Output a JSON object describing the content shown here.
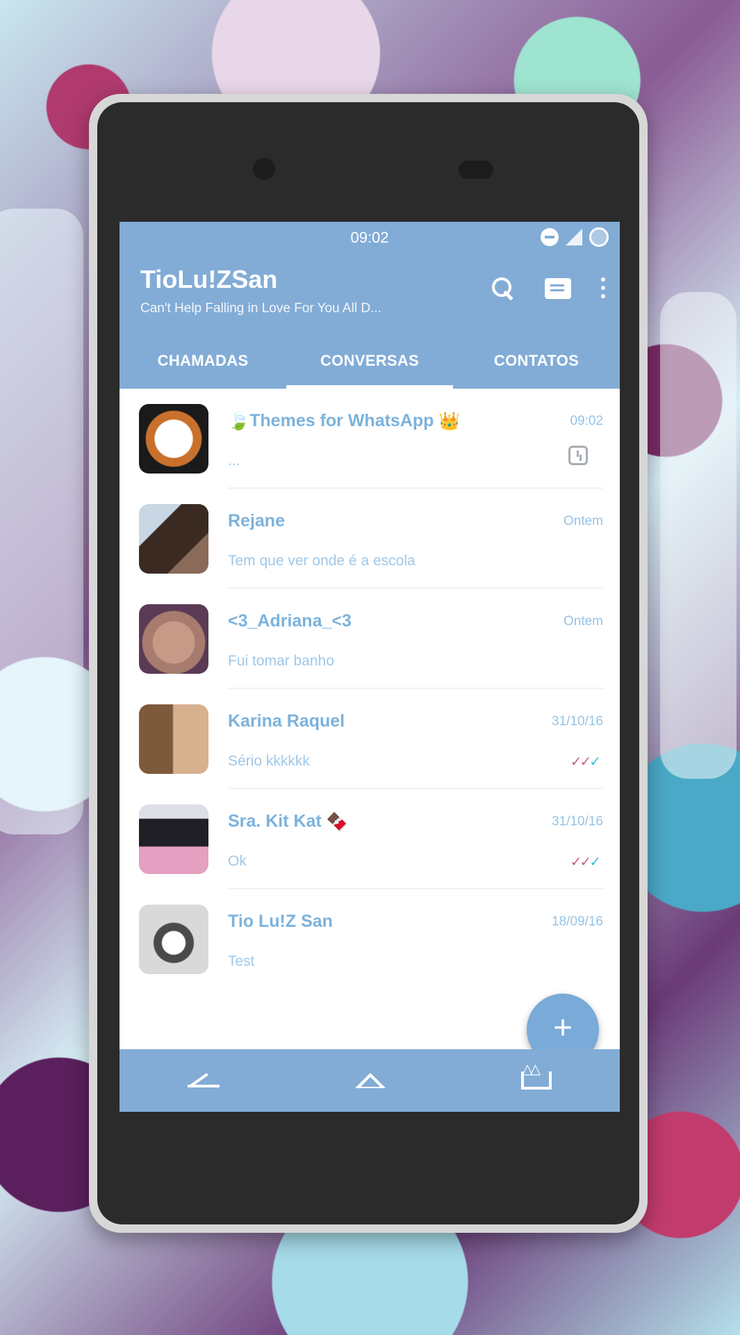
{
  "status_bar": {
    "time": "09:02"
  },
  "header": {
    "title": "TioLu!ZSan",
    "subtitle": "Can't Help Falling in Love For You All D...",
    "accent_color": "#82acd6"
  },
  "tabs": [
    {
      "label": "CHAMADAS",
      "active": false
    },
    {
      "label": "CONVERSAS",
      "active": true
    },
    {
      "label": "CONTATOS",
      "active": false
    }
  ],
  "chats": [
    {
      "name": "Themes for WhatsApp",
      "leading_emoji": "🍃",
      "trailing_emoji": "👑",
      "time": "09:02",
      "preview": "...",
      "status": "clock-icon",
      "avatar_colors": [
        "#ffffff",
        "#c9702c"
      ]
    },
    {
      "name": "Rejane",
      "time": "Ontem",
      "preview": "Tem que ver onde é a escola",
      "status": "",
      "avatar_colors": [
        "#3a2a22",
        "#c9d6e4"
      ]
    },
    {
      "name": "<3_Adriana_<3",
      "time": "Ontem",
      "preview": "Fui tomar banho",
      "status": "",
      "avatar_colors": [
        "#a77c6e",
        "#5a3a55"
      ]
    },
    {
      "name": "Karina Raquel",
      "time": "31/10/16",
      "preview": "Sério kkkkkk",
      "status": "double-check-icon",
      "avatar_colors": [
        "#d7b08f",
        "#7e5a3c"
      ]
    },
    {
      "name": "Sra. Kit Kat",
      "trailing_emoji": "🍫",
      "time": "31/10/16",
      "preview": "Ok",
      "status": "double-check-icon",
      "avatar_colors": [
        "#1f1f25",
        "#e4a0c0"
      ]
    },
    {
      "name": "Tio Lu!Z San",
      "time": "18/09/16",
      "preview": "Test",
      "status": "",
      "avatar_colors": [
        "#d9d9d9",
        "#4a4a4a"
      ]
    }
  ],
  "fab": {
    "label": "+"
  }
}
